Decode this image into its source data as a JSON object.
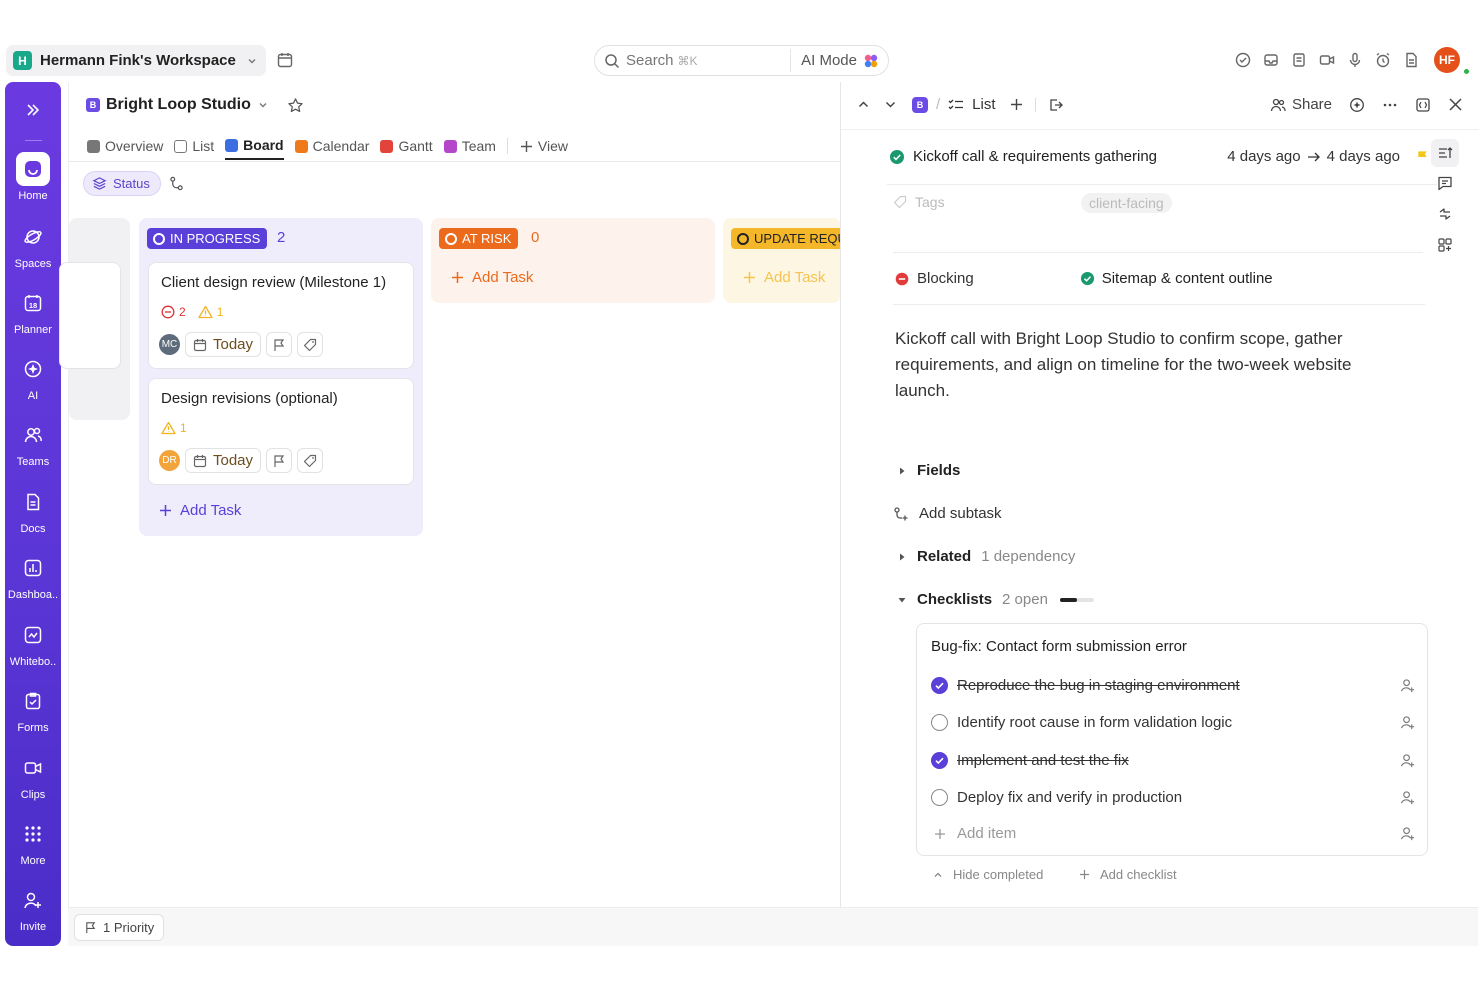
{
  "workspace": {
    "badge": "H",
    "name": "Hermann Fink's Workspace"
  },
  "search": {
    "placeholder": "Search",
    "shortcut": "⌘K",
    "ai_mode": "AI Mode"
  },
  "user": {
    "initials": "HF"
  },
  "sidebar": {
    "items": [
      {
        "label": "Home",
        "icon": "home-icon"
      },
      {
        "label": "Spaces",
        "icon": "spaces-icon"
      },
      {
        "label": "Planner",
        "icon": "planner-icon",
        "day": "18"
      },
      {
        "label": "AI",
        "icon": "ai-icon"
      },
      {
        "label": "Teams",
        "icon": "teams-icon"
      },
      {
        "label": "Docs",
        "icon": "docs-icon"
      },
      {
        "label": "Dashboa..",
        "icon": "dashboards-icon"
      },
      {
        "label": "Whitebo..",
        "icon": "whiteboards-icon"
      },
      {
        "label": "Forms",
        "icon": "forms-icon"
      },
      {
        "label": "Clips",
        "icon": "clips-icon"
      },
      {
        "label": "More",
        "icon": "more-icon"
      },
      {
        "label": "Invite",
        "icon": "invite-icon"
      }
    ]
  },
  "project": {
    "badge": "B",
    "name": "Bright Loop Studio"
  },
  "tabs": [
    {
      "label": "Overview",
      "color": "#777777"
    },
    {
      "label": "List",
      "color": "#777777"
    },
    {
      "label": "Board",
      "color": "#3b6ee0",
      "active": true
    },
    {
      "label": "Calendar",
      "color": "#f07a1a"
    },
    {
      "label": "Gantt",
      "color": "#e2443b"
    },
    {
      "label": "Team",
      "color": "#b447c9"
    }
  ],
  "add_view": "View",
  "filter": {
    "status": "Status"
  },
  "columns": [
    {
      "status": "IN PROGRESS",
      "count": "2",
      "color": "#5b3fd9",
      "cards": [
        {
          "title": "Client design review (Milestone 1)",
          "blocked": "2",
          "warnings": "1",
          "assignee": "MC",
          "assignee_color": "#5d6b7a",
          "due": "Today"
        },
        {
          "title": "Design revisions (optional)",
          "warnings": "1",
          "assignee": "DR",
          "assignee_color": "#f2a33a",
          "due": "Today"
        }
      ],
      "add": "Add Task"
    },
    {
      "status": "AT RISK",
      "count": "0",
      "color": "#ec6a1c",
      "add": "Add Task"
    },
    {
      "status": "UPDATE REQU",
      "color": "#f5b72a",
      "add": "Add Task"
    }
  ],
  "bottom": {
    "priority": "1 Priority"
  },
  "panel": {
    "crumb": {
      "badge": "B",
      "list": "List"
    },
    "share": "Share",
    "related_task": {
      "name": "Kickoff call & requirements gathering",
      "start": "4 days ago",
      "end": "4 days ago"
    },
    "tags": {
      "label": "Tags",
      "value": "client-facing"
    },
    "blocking": {
      "label": "Blocking",
      "task": "Sitemap & content outline"
    },
    "description": "Kickoff call with Bright Loop Studio to confirm scope, gather requirements, and align on timeline for the two-week website launch.",
    "fields": "Fields",
    "add_subtask": "Add subtask",
    "related": {
      "label": "Related",
      "sub": "1 dependency"
    },
    "checklists": {
      "label": "Checklists",
      "sub": "2 open",
      "progress": 0.5
    },
    "checklist": {
      "title": "Bug-fix: Contact form submission error",
      "items": [
        {
          "text": "Reproduce the bug in staging environment",
          "done": true
        },
        {
          "text": "Identify root cause in form validation logic",
          "done": false
        },
        {
          "text": "Implement and test the fix",
          "done": true
        },
        {
          "text": "Deploy fix and verify in production",
          "done": false
        }
      ],
      "add_item": "Add item"
    },
    "hide_completed": "Hide completed",
    "add_checklist": "Add checklist"
  }
}
